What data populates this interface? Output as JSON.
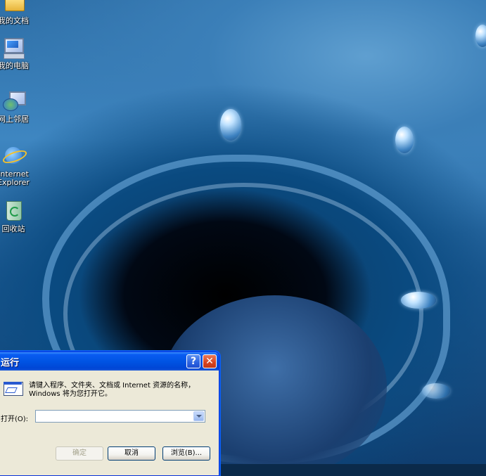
{
  "desktop": {
    "icons": [
      {
        "label": "我的文档",
        "icon": "my-documents-icon"
      },
      {
        "label": "我的电脑",
        "icon": "my-computer-icon"
      },
      {
        "label": "网上邻居",
        "icon": "network-places-icon"
      },
      {
        "label": "Internet\nExplorer",
        "icon": "internet-explorer-icon"
      },
      {
        "label": "回收站",
        "icon": "recycle-bin-icon"
      }
    ]
  },
  "run_dialog": {
    "title": "运行",
    "help_button": "?",
    "close_button": "✕",
    "prompt": "请键入程序、文件夹、文档或 Internet 资源的名称，Windows 将为您打开它。",
    "open_label": "打开(O):",
    "open_value": "",
    "ok_label": "确定",
    "cancel_label": "取消",
    "browse_label": "浏览(B)...",
    "ok_enabled": false
  }
}
